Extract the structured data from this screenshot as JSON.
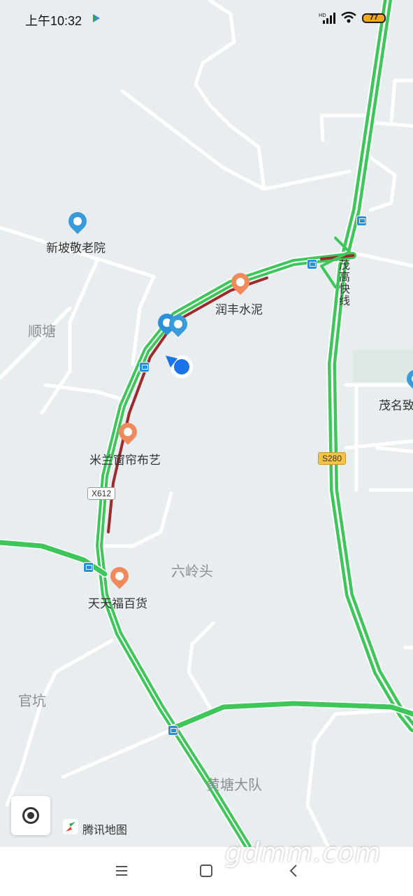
{
  "status_bar": {
    "time": "上午10:32",
    "network": "HD",
    "battery_level": "77"
  },
  "map": {
    "pois": [
      {
        "name": "新坡敬老院",
        "icon": "pin-icon",
        "color": "#3a9bdc"
      },
      {
        "name": "润丰水泥",
        "icon": "shop-icon",
        "color": "#f08a5d"
      },
      {
        "name": "米兰窗帘布艺",
        "icon": "shop-icon",
        "color": "#f08a5d"
      },
      {
        "name": "天天福百货",
        "icon": "cart-icon",
        "color": "#f08a5d"
      },
      {
        "name": "茂名致",
        "icon": "pin-icon",
        "color": "#3a9bdc"
      }
    ],
    "area_labels": [
      "顺塘",
      "六岭头",
      "官坑",
      "黄塘大队"
    ],
    "road_labels": {
      "expressway": "茂高快线",
      "county_road": "X612",
      "provincial_road": "S280"
    },
    "attribution": "腾讯地图"
  },
  "watermark": "gdmm.com",
  "colors": {
    "map_background": "#e8edf0",
    "road_green": "#3ec65a",
    "road_red": "#9e2b2b",
    "location_blue": "#1a73e8",
    "poi_orange": "#f08a5d",
    "poi_blue": "#3a9bdc",
    "bus_blue": "#2f8fd6"
  }
}
